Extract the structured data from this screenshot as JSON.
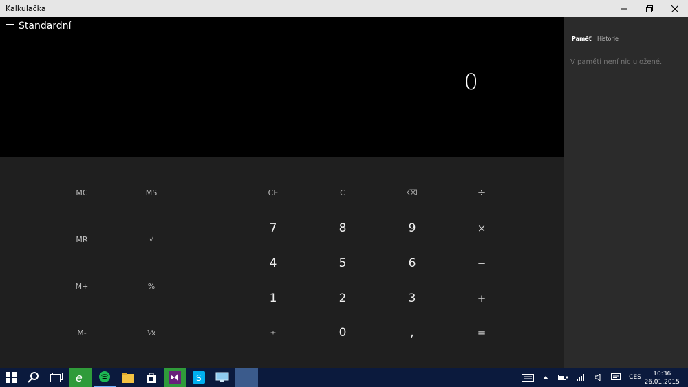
{
  "window": {
    "title": "Kalkulačka"
  },
  "header": {
    "mode": "Standardní"
  },
  "display": {
    "value": "0"
  },
  "memory_keys": {
    "mc": "MC",
    "ms": "MS",
    "mr": "MR",
    "mplus": "M+",
    "mminus": "M-"
  },
  "sci_keys": {
    "sqrt": "√",
    "percent": "%",
    "recip": "⅟x"
  },
  "keys": {
    "ce": "CE",
    "c": "C",
    "backspace": "⌫",
    "divide": "÷",
    "n7": "7",
    "n8": "8",
    "n9": "9",
    "multiply": "×",
    "n4": "4",
    "n5": "5",
    "n6": "6",
    "minus": "−",
    "n1": "1",
    "n2": "2",
    "n3": "3",
    "plus": "+",
    "negate": "±",
    "n0": "0",
    "decimal": ",",
    "equals": "="
  },
  "side": {
    "tab_memory": "Paměť",
    "tab_history": "Historie",
    "empty_text": "V paměti není nic uložené."
  },
  "taskbar": {
    "lang": "CES",
    "time": "10:36",
    "date": "26.01.2015",
    "icons": [
      "windows-start-icon",
      "search-icon",
      "task-view-icon",
      "internet-explorer-icon",
      "spotify-icon",
      "file-explorer-icon",
      "store-icon",
      "visual-studio-icon",
      "skype-icon",
      "remote-desktop-icon",
      "calculator-app-icon"
    ]
  },
  "colors": {
    "accent_green": "#2f9b3a",
    "taskbar": "#0b1a3d",
    "keypad": "#1f1f1f",
    "side_panel": "#2b2b2b"
  }
}
